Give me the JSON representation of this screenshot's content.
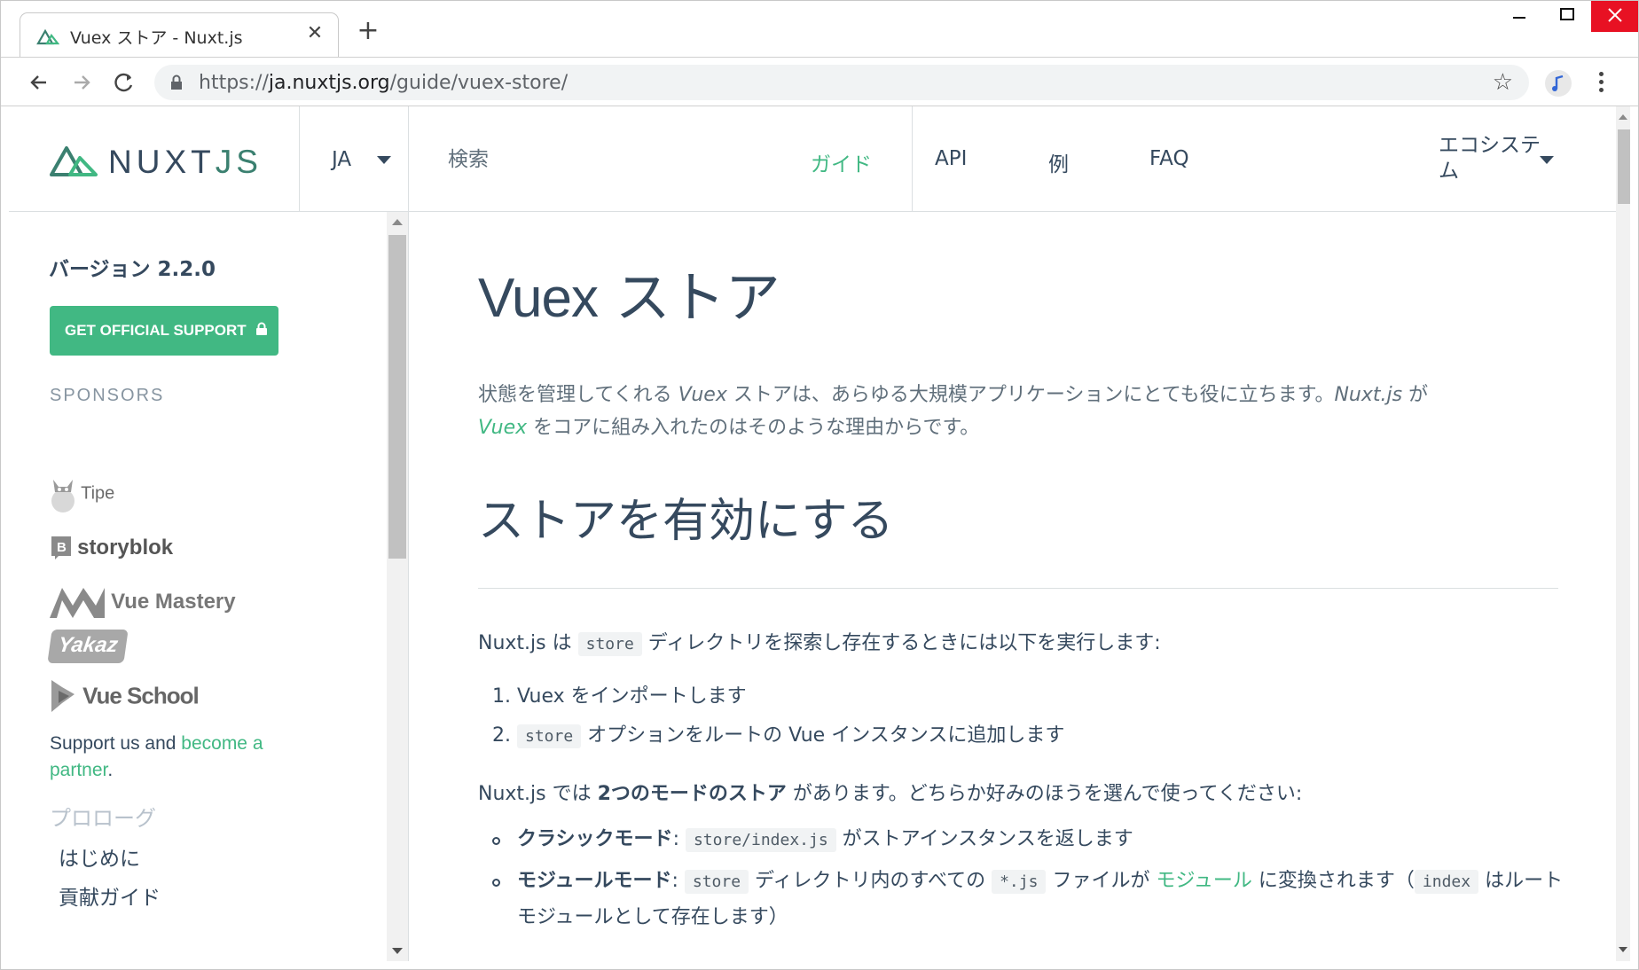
{
  "browser": {
    "tab_title": "Vuex ストア - Nuxt.js",
    "tab_close": "✕",
    "new_tab": "+",
    "url_scheme": "https://",
    "url_host": "ja.nuxtjs.org",
    "url_path": "/guide/vuex-store/",
    "window_minimize": "—",
    "window_maximize": "☐",
    "window_close": "✕"
  },
  "header": {
    "logo_text_main": "NUXT",
    "logo_text_accent": "JS",
    "language": "JA",
    "search_placeholder": "検索",
    "nav": [
      "ガイド",
      "API",
      "例",
      "FAQ"
    ],
    "nav_active": "ガイド",
    "ecosystem": "エコシステム"
  },
  "sidebar": {
    "version": "バージョン 2.2.0",
    "support_button": "GET OFFICIAL SUPPORT",
    "sponsors_heading": "SPONSORS",
    "sponsors": [
      "Tipe",
      "storyblok",
      "Vue Mastery",
      "Yakaz",
      "Vue School"
    ],
    "support_text": "Support us and ",
    "support_link": "become a partner",
    "support_end": ".",
    "section_title": "プロローグ",
    "links": [
      "はじめに",
      "貢献ガイド"
    ]
  },
  "content": {
    "title_en": "Vuex",
    "title_ja": " ストア",
    "lead_1": "状態を管理してくれる ",
    "lead_vuex": "Vuex",
    "lead_2": " ストアは、あらゆる大規模アプリケーションにとても役に立ちます。",
    "lead_nuxt": "Nuxt.js",
    "lead_3": " が",
    "lead_vuex2": "Vuex",
    "lead_4": " をコアに組み入れたのはそのような理由からです。",
    "section_heading": "ストアを有効にする",
    "p1_a": "Nuxt.js は ",
    "p1_code": "store",
    "p1_b": " ディレクトリを探索し存在するときには以下を実行します:",
    "ol": [
      {
        "num": "1.",
        "text": "Vuex をインポートします"
      },
      {
        "num": "2.",
        "code": "store",
        "text": " オプションをルートの Vue インスタンスに追加します"
      }
    ],
    "p2_a": "Nuxt.js では ",
    "p2_b": "2つのモードのストア",
    "p2_c": " があります。どちらか好みのほうを選んで使ってください:",
    "ul1_bold": "クラシックモード",
    "ul1_colon": ": ",
    "ul1_code": "store/index.js",
    "ul1_text": " がストアインスタンスを返します",
    "ul2_bold": "モジュールモード",
    "ul2_colon": ": ",
    "ul2_code1": "store",
    "ul2_text1": " ディレクトリ内のすべての ",
    "ul2_code2": "*.js",
    "ul2_text2": " ファイルが ",
    "ul2_link": "モジュール",
    "ul2_text3": " に変換されます（",
    "ul2_code3": "index",
    "ul2_text4": " はルートモジュールとして存在します）"
  },
  "colors": {
    "accent": "#41b883",
    "text": "#35495e",
    "muted": "#606f7b"
  }
}
